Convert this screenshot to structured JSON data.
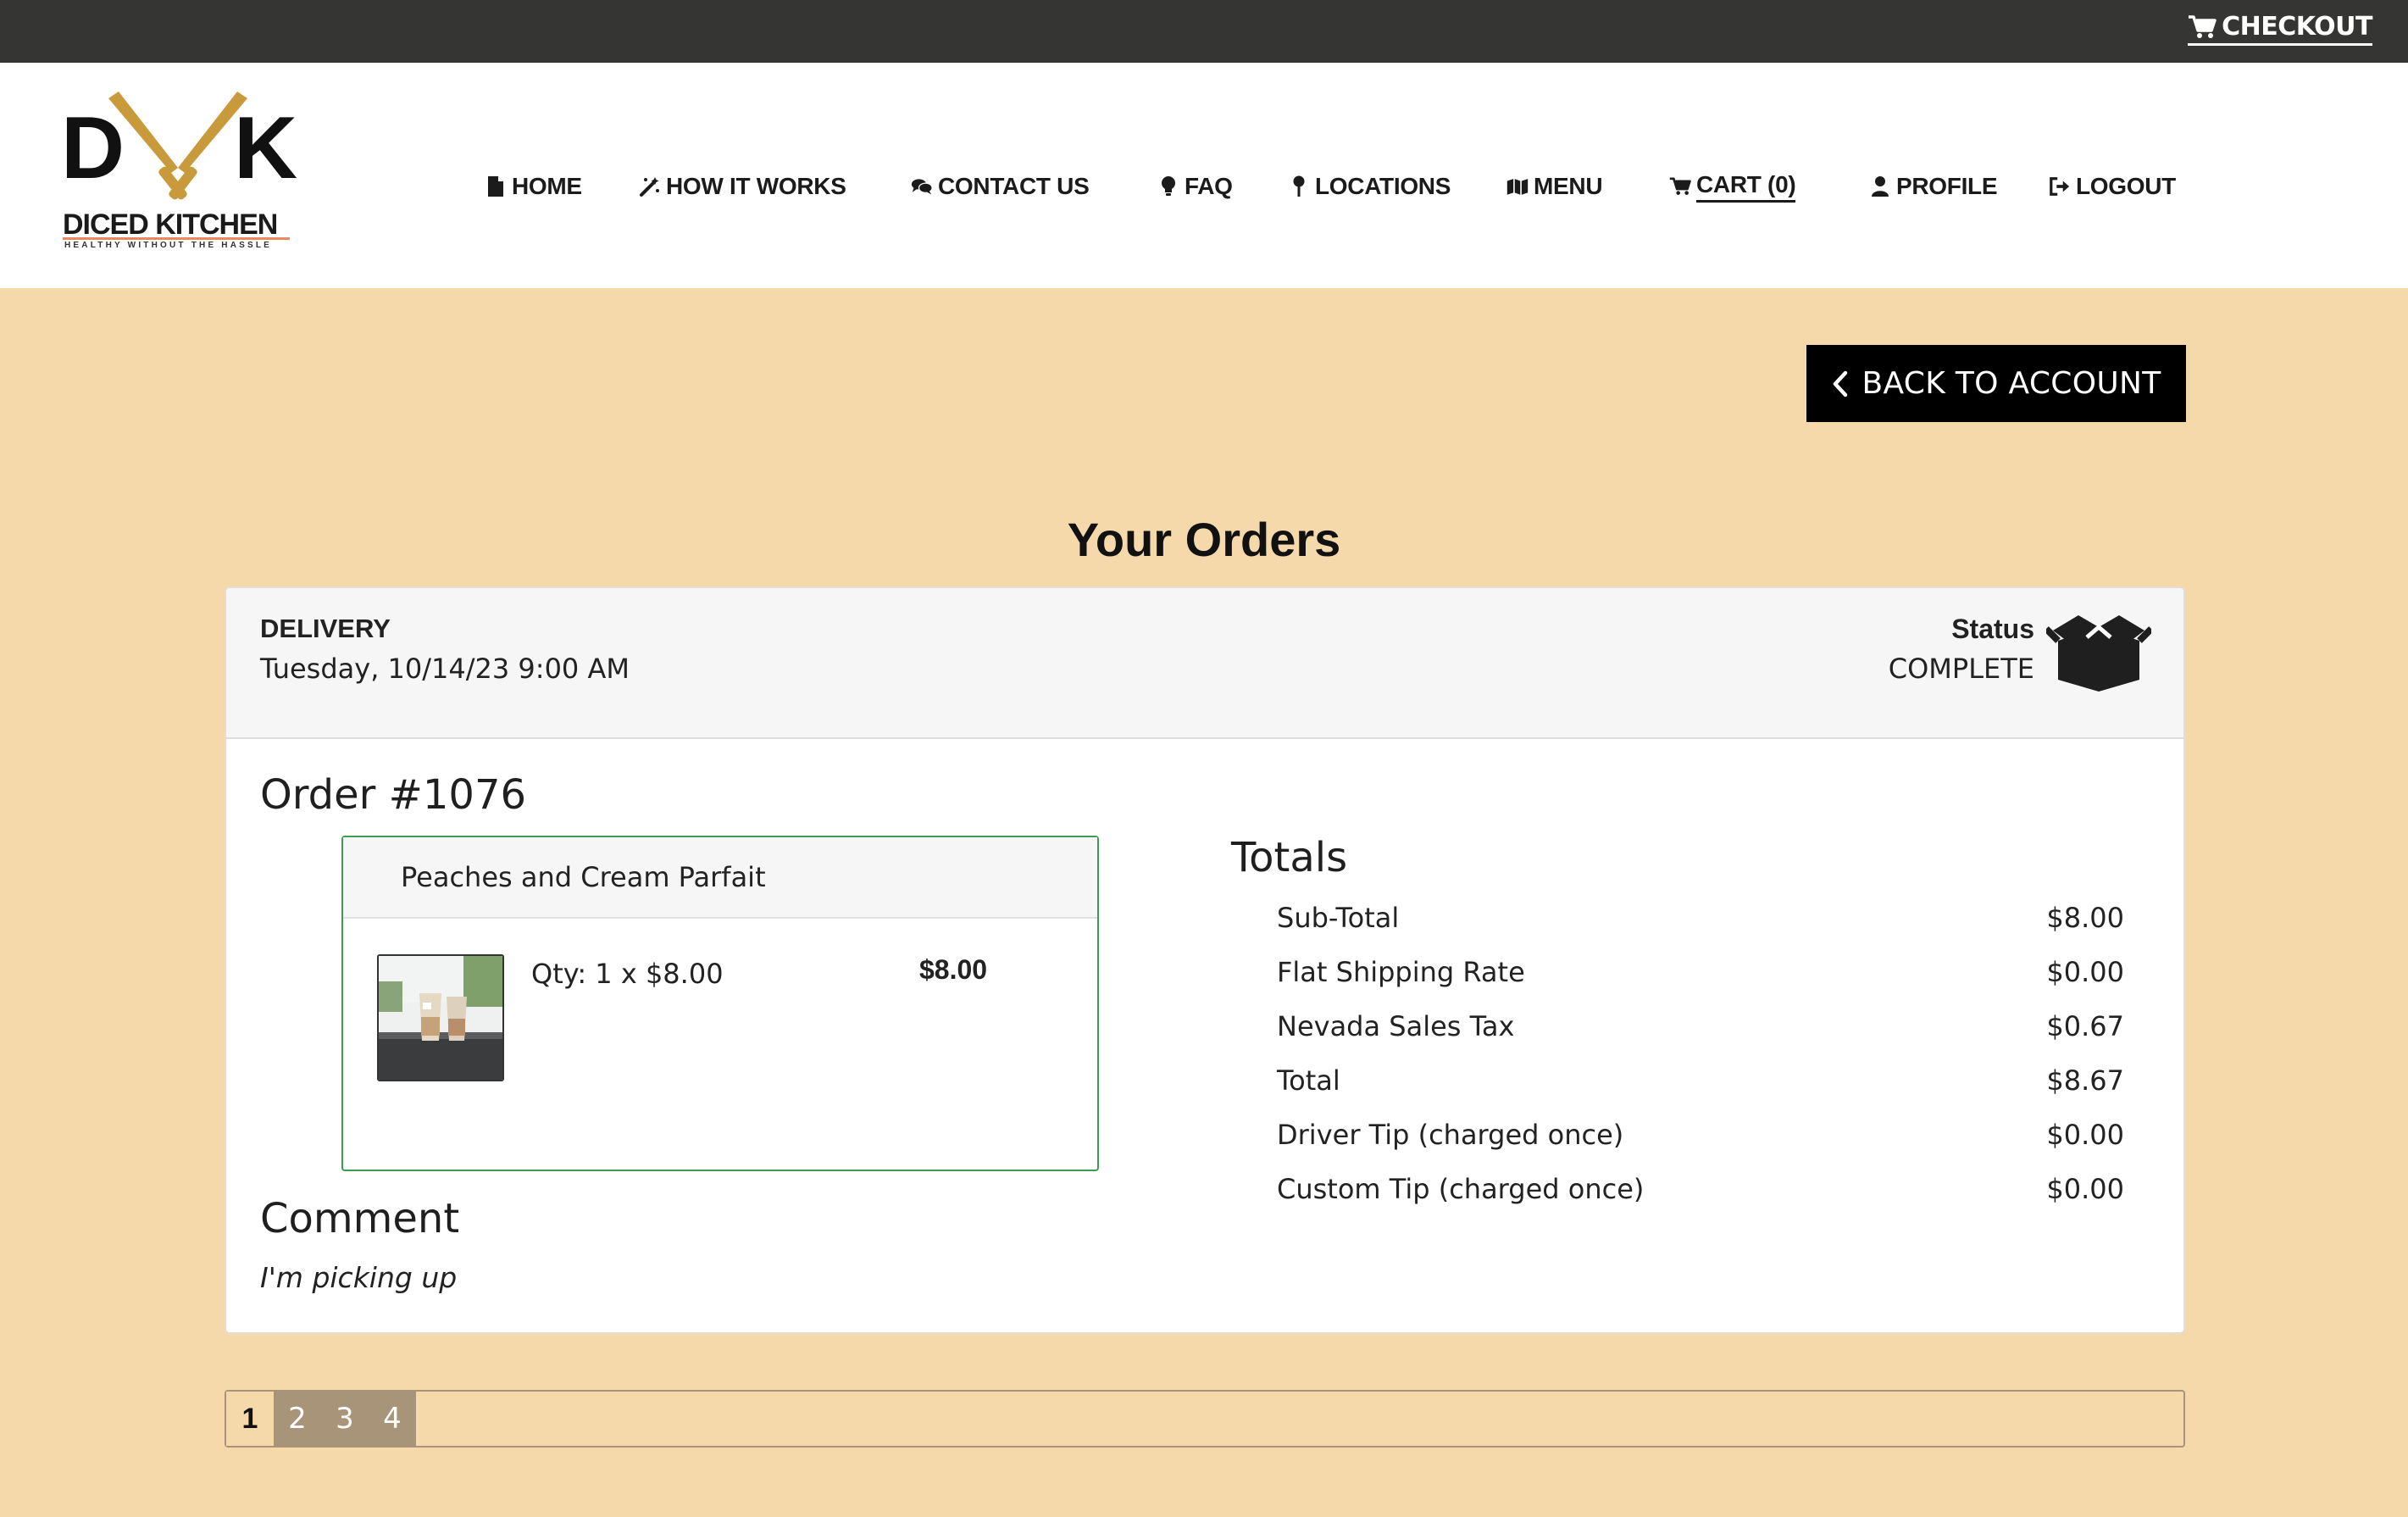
{
  "topbar": {
    "checkout_label": "CHECKOUT",
    "checkout_icon": "cart-icon"
  },
  "logo": {
    "letters": "DK",
    "brand": "DICED KITCHEN",
    "tagline": "HEALTHY WITHOUT THE HASSLE"
  },
  "nav": [
    {
      "label": "HOME",
      "icon": "file-icon"
    },
    {
      "label": "HOW IT WORKS",
      "icon": "magic-wand-icon"
    },
    {
      "label": "CONTACT US",
      "icon": "comments-icon"
    },
    {
      "label": "FAQ",
      "icon": "lightbulb-icon"
    },
    {
      "label": "LOCATIONS",
      "icon": "map-pin-icon"
    },
    {
      "label": "MENU",
      "icon": "map-icon"
    },
    {
      "label": "CART (0)",
      "icon": "cart-icon",
      "active": true
    },
    {
      "label": "PROFILE",
      "icon": "user-icon"
    },
    {
      "label": "LOGOUT",
      "icon": "sign-out-icon"
    }
  ],
  "back_button": {
    "label": "BACK TO ACCOUNT",
    "icon": "chevron-left-icon"
  },
  "page_title": "Your Orders",
  "order": {
    "method": "DELIVERY",
    "datetime": "Tuesday, 10/14/23 9:00 AM",
    "status_label": "Status",
    "status_value": "COMPLETE",
    "status_icon": "open-box-icon",
    "number": "Order #1076",
    "item": {
      "name": "Peaches and Cream Parfait",
      "qty_text": "Qty: 1 x $8.00",
      "price": "$8.00"
    },
    "comment_title": "Comment",
    "comment_text": "I'm picking up",
    "totals_title": "Totals",
    "totals": [
      {
        "label": "Sub-Total",
        "value": "$8.00"
      },
      {
        "label": "Flat Shipping Rate",
        "value": "$0.00"
      },
      {
        "label": "Nevada Sales Tax",
        "value": "$0.67"
      },
      {
        "label": "Total",
        "value": "$8.67"
      },
      {
        "label": "Driver Tip (charged once)",
        "value": "$0.00"
      },
      {
        "label": "Custom Tip (charged once)",
        "value": "$0.00"
      }
    ]
  },
  "pagination": {
    "pages": [
      "1",
      "2",
      "3",
      "4"
    ],
    "current": "1"
  },
  "colors": {
    "page_bg": "#f5d9ab",
    "topbar_bg": "#353634",
    "item_border": "#3f9b4f",
    "pager_bg": "#a89579",
    "knife_gold": "#c99a3c"
  }
}
